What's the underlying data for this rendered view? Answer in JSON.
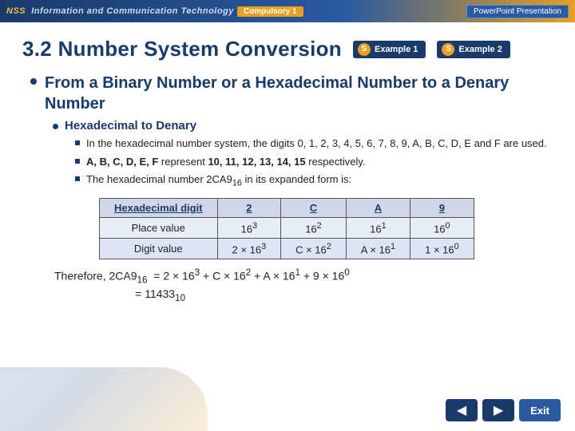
{
  "header": {
    "logo_text": "NSS Information and Communication Technology",
    "compulsory_label": "Compulsory 1",
    "ppt_label": "PowerPoint Presentation"
  },
  "title": "3.2  Number System Conversion",
  "examples": [
    {
      "label": "Example 1"
    },
    {
      "label": "Example 2"
    }
  ],
  "bullet_l1": "From a Binary Number or a Hexadecimal Number to a Denary Number",
  "bullet_l2": "Hexadecimal to Denary",
  "bullet_l3": [
    "In the hexadecimal number system, the digits 0, 1, 2, 3, 4, 5, 6, 7, 8, 9, A, B, C, D, E and F are used.",
    "A, B, C, D, E, F represent 10, 11, 12, 13, 14, 15 respectively.",
    "The hexadecimal number 2CA9₁₆ in its expanded form is:"
  ],
  "table": {
    "headers": [
      "Hexadecimal digit",
      "2",
      "C",
      "A",
      "9"
    ],
    "row2_label": "Place value",
    "row2_vals": [
      "16³",
      "16²",
      "16¹",
      "16⁰"
    ],
    "row3_label": "Digit value",
    "row3_vals": [
      "2 × 16³",
      "C × 16²",
      "A × 16¹",
      "1 × 16⁰"
    ]
  },
  "therefore": {
    "line1": "Therefore, 2CA9₁₆  =  2 × 16³ + C × 16² + A × 16¹ + 9 × 16⁰",
    "line2": "= 11433₁₀"
  },
  "nav": {
    "back_icon": "◀",
    "forward_icon": "▶",
    "exit_label": "Exit"
  }
}
